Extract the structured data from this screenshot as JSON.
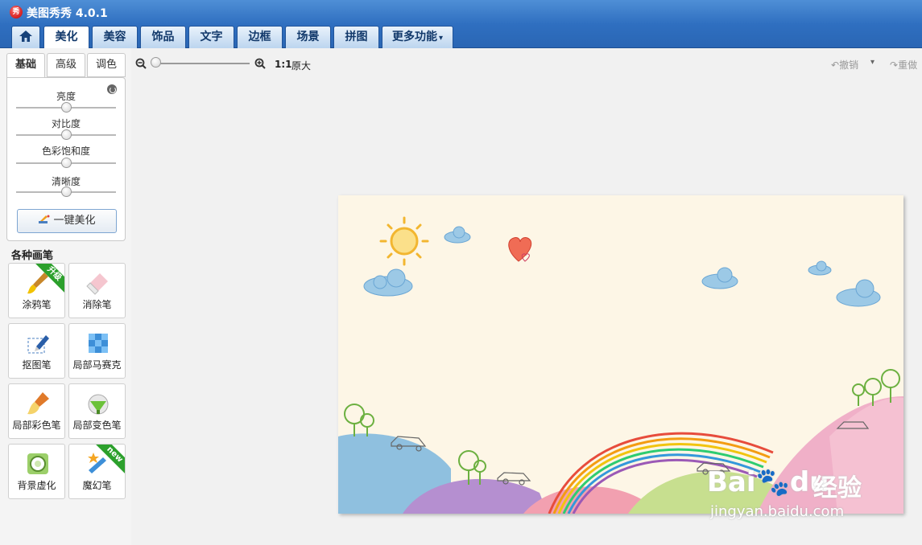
{
  "window": {
    "title": "美图秀秀 4.0.1",
    "logo_text": "秀"
  },
  "tabs": [
    {
      "label": "",
      "icon": "home-icon"
    },
    {
      "label": "美化"
    },
    {
      "label": "美容"
    },
    {
      "label": "饰品"
    },
    {
      "label": "文字"
    },
    {
      "label": "边框"
    },
    {
      "label": "场景"
    },
    {
      "label": "拼图"
    },
    {
      "label": "更多功能"
    }
  ],
  "subtabs": [
    "基础",
    "高级",
    "调色"
  ],
  "sliders": [
    {
      "label": "亮度",
      "value": 0.5
    },
    {
      "label": "对比度",
      "value": 0.5
    },
    {
      "label": "色彩饱和度",
      "value": 0.5
    },
    {
      "label": "清晰度",
      "value": 0.5
    }
  ],
  "one_click_label": "一键美化",
  "brushes_title": "各种画笔",
  "brushes": [
    {
      "label": "涂鸦笔",
      "icon": "paintbrush-icon",
      "ribbon": "升级"
    },
    {
      "label": "消除笔",
      "icon": "eraser-icon"
    },
    {
      "label": "抠图笔",
      "icon": "cutout-pen-icon"
    },
    {
      "label": "局部马赛克",
      "icon": "mosaic-icon"
    },
    {
      "label": "局部彩色笔",
      "icon": "color-brush-icon"
    },
    {
      "label": "局部变色笔",
      "icon": "color-change-icon"
    },
    {
      "label": "背景虚化",
      "icon": "blur-icon"
    },
    {
      "label": "魔幻笔",
      "icon": "magic-pen-icon",
      "ribbon": "new"
    }
  ],
  "toolbar": {
    "ratio_label": "1:1",
    "original_label": "原大",
    "undo_label": "撤销",
    "redo_label": "重做",
    "zoom_level": 0
  },
  "watermark": {
    "brand": "Bai",
    "brand_rest": "du",
    "cn": "经验",
    "url": "jingyan.baidu.com"
  },
  "colors": {
    "titlebar": "#2f6fc0",
    "canvas_bg": "#fdf6e6",
    "accent_green": "#2ca02c"
  }
}
